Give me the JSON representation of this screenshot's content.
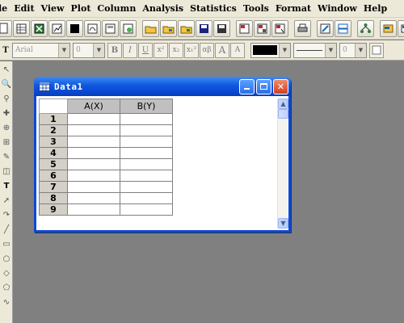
{
  "menu": [
    "le",
    "Edit",
    "View",
    "Plot",
    "Column",
    "Analysis",
    "Statistics",
    "Tools",
    "Format",
    "Window",
    "Help"
  ],
  "format_toolbar": {
    "font_name": "Arial",
    "font_size": "0",
    "bold": "B",
    "italic": "I",
    "underline": "U",
    "superscript": "x²",
    "subscript": "x₂",
    "supsub": "x₁²",
    "greek": "αβ",
    "grow_font": "A",
    "shrink_font": "A",
    "text_tool": "T",
    "line_width": "0"
  },
  "workbook": {
    "title": "Data1",
    "columns": [
      "A(X)",
      "B(Y)"
    ],
    "rows": [
      "1",
      "2",
      "3",
      "4",
      "5",
      "6",
      "7",
      "8",
      "9"
    ]
  },
  "colors": {
    "title_blue": "#0a48d6",
    "workspace": "#808080",
    "chrome": "#ece9d8"
  }
}
